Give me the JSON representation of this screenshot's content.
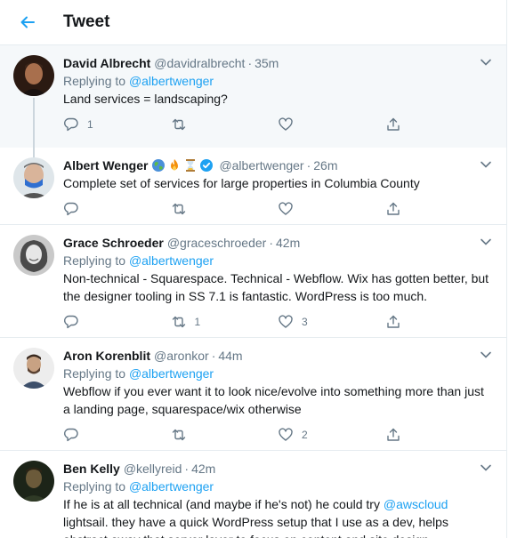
{
  "header": {
    "title": "Tweet"
  },
  "tweets": [
    {
      "name": "David Albrecht",
      "handle": "@davidralbrecht",
      "time": "35m",
      "replying_prefix": "Replying to ",
      "replying_to": "@albertwenger",
      "text": "Land services = landscaping?",
      "counts": {
        "reply": "1",
        "retweet": "",
        "like": ""
      },
      "highlighted": true
    },
    {
      "name": "Albert Wenger",
      "handle": "@albertwenger",
      "time": "26m",
      "emoji_icons": [
        "globe-icon",
        "fire-icon",
        "hourglass-icon",
        "verified-badge-icon"
      ],
      "text": "Complete set of services for large properties in Columbia County",
      "counts": {
        "reply": "",
        "retweet": "",
        "like": ""
      }
    },
    {
      "name": "Grace Schroeder",
      "handle": "@graceschroeder",
      "time": "42m",
      "replying_prefix": "Replying to ",
      "replying_to": "@albertwenger",
      "text": "Non-technical - Squarespace. Technical - Webflow. Wix has gotten better, but the designer tooling in SS 7.1 is fantastic. WordPress is too much.",
      "counts": {
        "reply": "",
        "retweet": "1",
        "like": "3"
      }
    },
    {
      "name": "Aron Korenblit",
      "handle": "@aronkor",
      "time": "44m",
      "replying_prefix": "Replying to ",
      "replying_to": "@albertwenger",
      "text": "Webflow if you ever want it to look nice/evolve into something more than just a landing page, squarespace/wix otherwise",
      "counts": {
        "reply": "",
        "retweet": "",
        "like": "2"
      }
    },
    {
      "name": "Ben Kelly",
      "handle": "@kellyreid",
      "time": "42m",
      "replying_prefix": "Replying to ",
      "replying_to": "@albertwenger",
      "text_before": "If he is at all technical (and maybe if he's not) he could try ",
      "text_mention": "@awscloud",
      "text_after": " lightsail.  they have a quick WordPress setup that I use as a dev, helps abstract away that server layer to focus on content and site design."
    }
  ],
  "dot": "·",
  "colors": {
    "accent": "#1da1f2",
    "secondary": "#657786",
    "border": "#e6ecf0",
    "highlight_bg": "#f5f8fa"
  }
}
